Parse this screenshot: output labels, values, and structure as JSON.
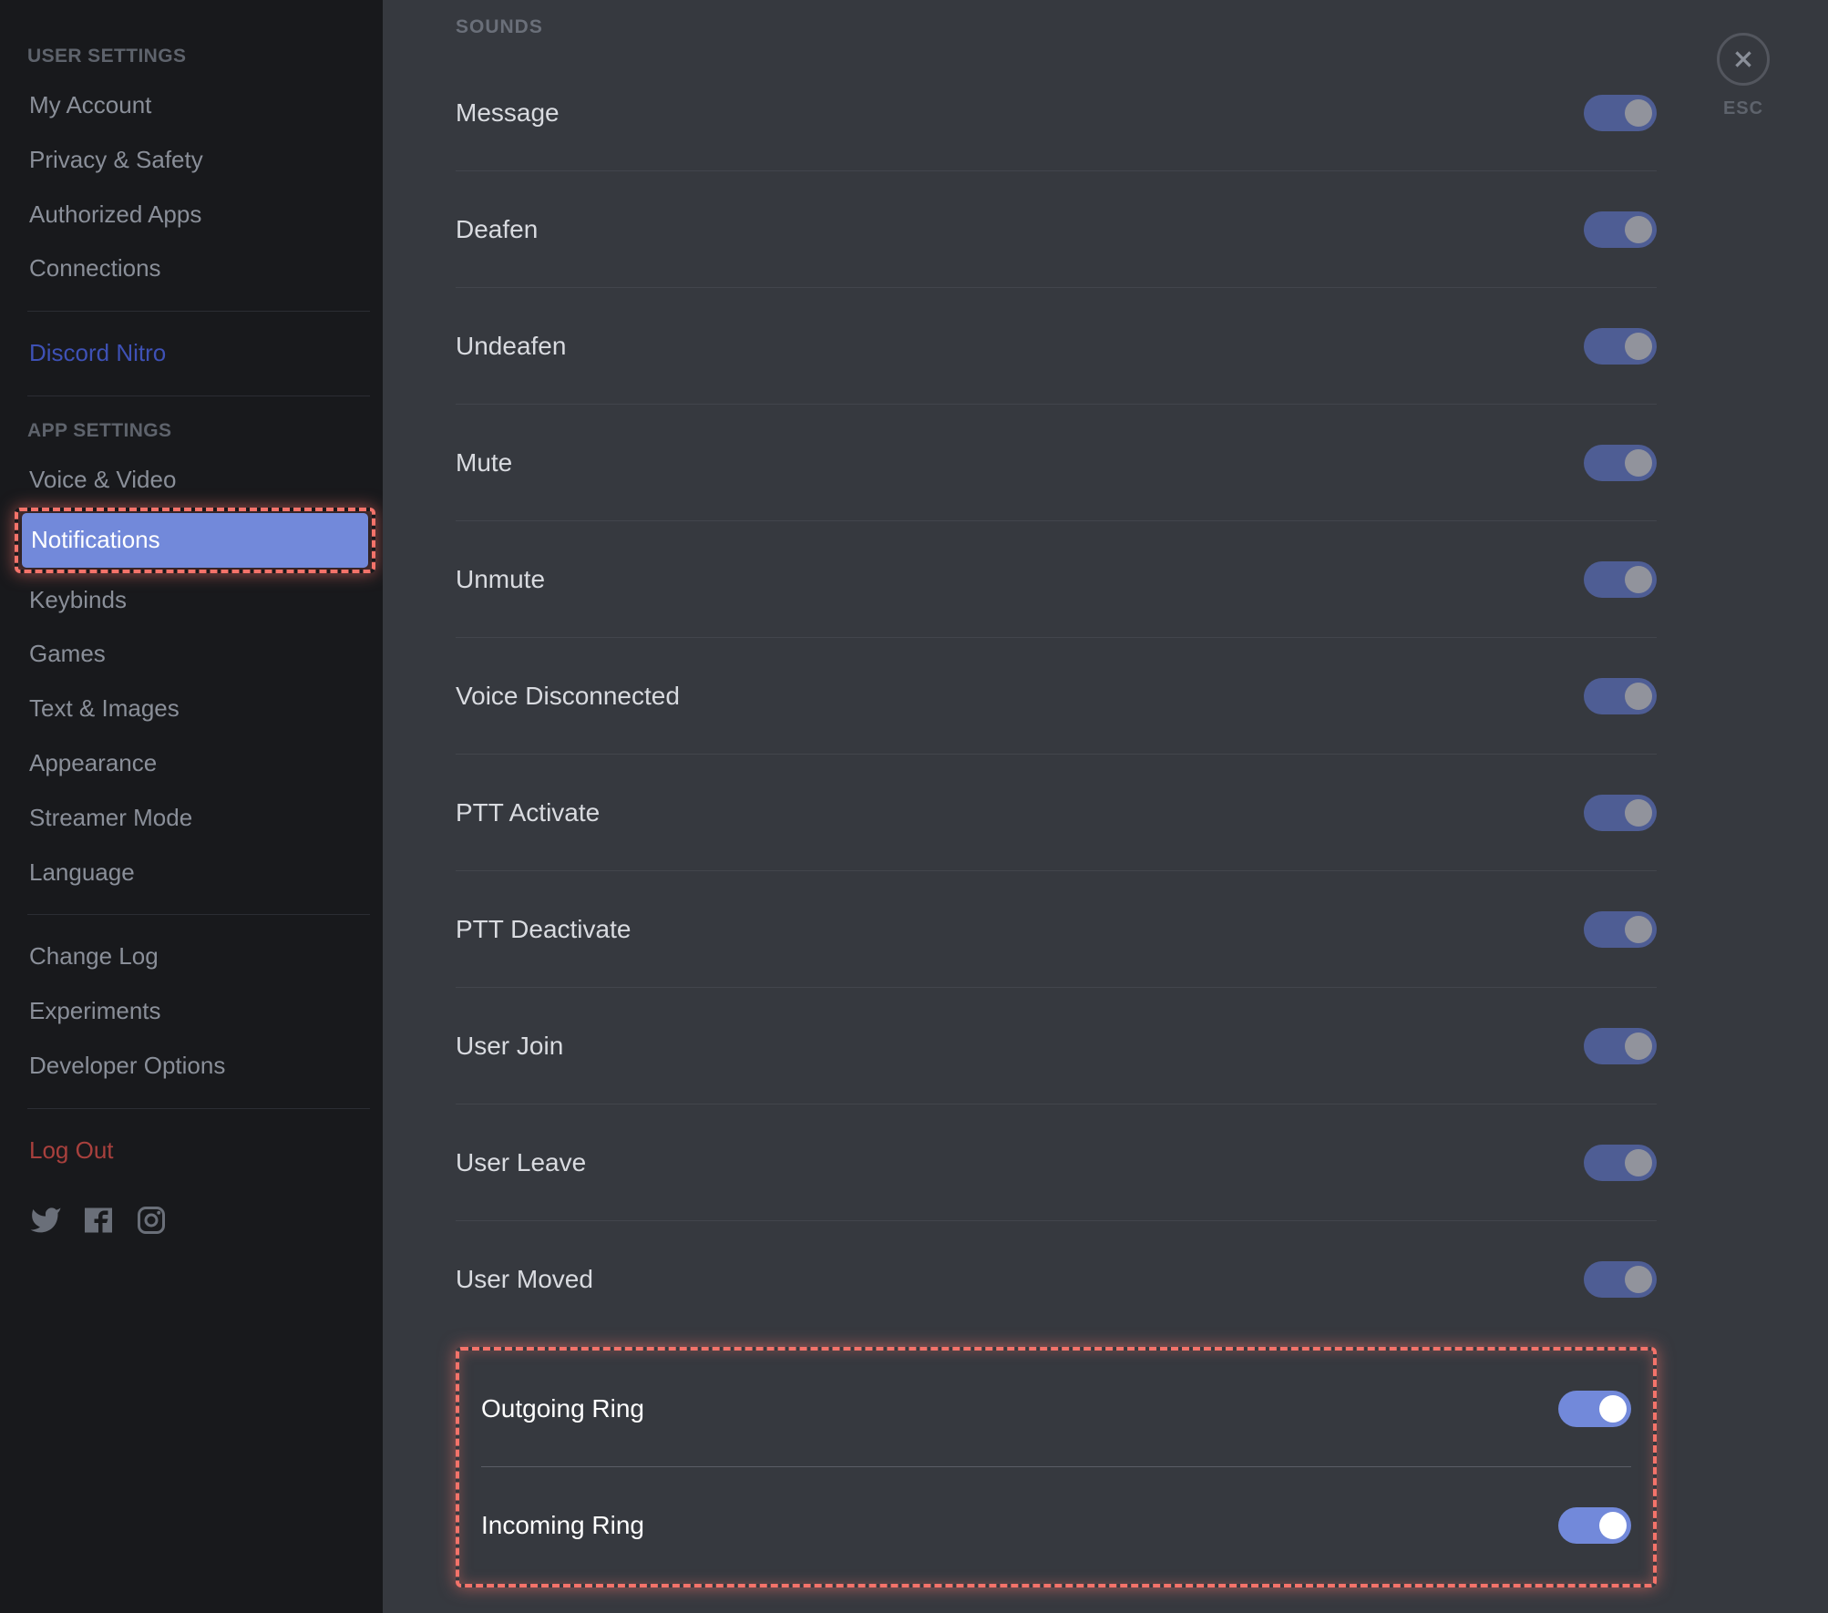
{
  "sidebar": {
    "userSettingsHeader": "USER SETTINGS",
    "appSettingsHeader": "APP SETTINGS",
    "items": {
      "myAccount": "My Account",
      "privacySafety": "Privacy & Safety",
      "authorizedApps": "Authorized Apps",
      "connections": "Connections",
      "discordNitro": "Discord Nitro",
      "voiceVideo": "Voice & Video",
      "notifications": "Notifications",
      "keybinds": "Keybinds",
      "games": "Games",
      "textImages": "Text & Images",
      "appearance": "Appearance",
      "streamerMode": "Streamer Mode",
      "language": "Language",
      "changeLog": "Change Log",
      "experiments": "Experiments",
      "developerOptions": "Developer Options",
      "logOut": "Log Out"
    }
  },
  "main": {
    "sectionTitle": "SOUNDS",
    "sounds": [
      {
        "label": "Message",
        "on": true,
        "bright": false
      },
      {
        "label": "Deafen",
        "on": true,
        "bright": false
      },
      {
        "label": "Undeafen",
        "on": true,
        "bright": false
      },
      {
        "label": "Mute",
        "on": true,
        "bright": false
      },
      {
        "label": "Unmute",
        "on": true,
        "bright": false
      },
      {
        "label": "Voice Disconnected",
        "on": true,
        "bright": false
      },
      {
        "label": "PTT Activate",
        "on": true,
        "bright": false
      },
      {
        "label": "PTT Deactivate",
        "on": true,
        "bright": false
      },
      {
        "label": "User Join",
        "on": true,
        "bright": false
      },
      {
        "label": "User Leave",
        "on": true,
        "bright": false
      },
      {
        "label": "User Moved",
        "on": true,
        "bright": false
      }
    ],
    "highlightedSounds": [
      {
        "label": "Outgoing Ring",
        "on": true,
        "bright": true
      },
      {
        "label": "Incoming Ring",
        "on": true,
        "bright": true
      }
    ]
  },
  "close": {
    "esc": "ESC"
  }
}
